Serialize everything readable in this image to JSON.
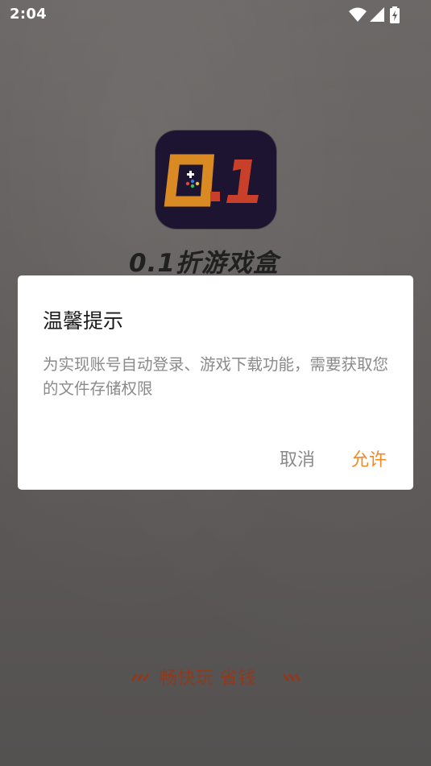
{
  "status_bar": {
    "time": "2:04",
    "icons": [
      "wifi-icon",
      "cell-signal-icon",
      "battery-charging-icon"
    ]
  },
  "splash": {
    "logo_text": "0.1",
    "app_name": "0.1折游戏盒",
    "slogan": "畅快玩 省钱"
  },
  "dialog": {
    "title": "温馨提示",
    "message": "为实现账号自动登录、游戏下载功能，需要获取您的文件存储权限",
    "cancel_label": "取消",
    "allow_label": "允许"
  },
  "colors": {
    "accent": "#f08a24",
    "slogan": "#8f3a1c",
    "logo_bg": "#1c1430",
    "logo_gold": "#d98a22",
    "logo_red": "#c9402a"
  }
}
